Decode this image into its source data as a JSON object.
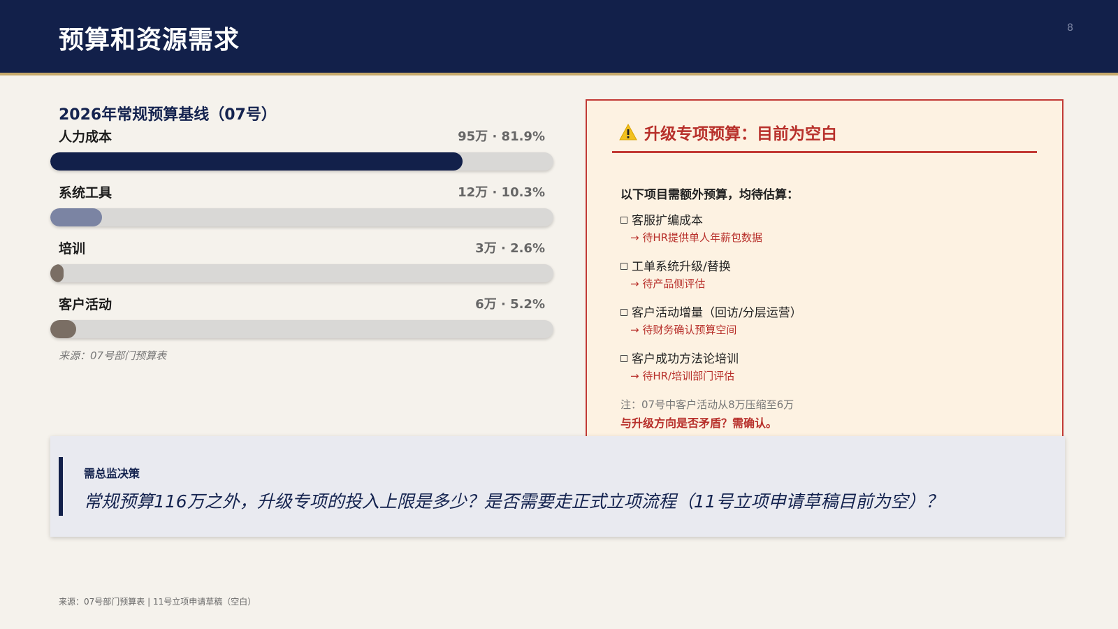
{
  "header": {
    "title": "预算和资源需求",
    "page_number": "8"
  },
  "baseline": {
    "title": "2026年常规预算基线（07号）",
    "items": [
      {
        "name": "人力成本",
        "amount": "95万 · 81.9%",
        "share": 0.819,
        "color": "#12204a"
      },
      {
        "name": "系统工具",
        "amount": "12万 · 10.3%",
        "share": 0.103,
        "color": "#7b84a3"
      },
      {
        "name": "培训",
        "amount": "3万 · 2.6%",
        "share": 0.026,
        "color": "#7a6e64"
      },
      {
        "name": "客户活动",
        "amount": "6万 · 5.2%",
        "share": 0.052,
        "color": "#7a6e64"
      }
    ],
    "source": "来源：07号部门预算表"
  },
  "upgrade": {
    "icon": "warning-icon",
    "title": "升级专项预算：目前为空白",
    "intro": "以下项目需额外预算，均待估算：",
    "items": [
      {
        "name": "客服扩编成本",
        "note": "→ 待HR提供单人年薪包数据"
      },
      {
        "name": "工单系统升级/替换",
        "note": "→ 待产品侧评估"
      },
      {
        "name": "客户活动增量（回访/分层运营）",
        "note": "→ 待财务确认预算空间"
      },
      {
        "name": "客户成功方法论培训",
        "note": "→ 待HR/培训部门评估"
      }
    ],
    "note_line1": "注：07号中客户活动从8万压缩至6万",
    "note_line2": "与升级方向是否矛盾？需确认。"
  },
  "decision": {
    "label": "需总监决策",
    "question": "常规预算116万之外，升级专项的投入上限是多少？是否需要走正式立项流程（11号立项申请草稿目前为空）？"
  },
  "footer": {
    "source": "来源：07号部门预算表 | 11号立项申请草稿（空白）"
  },
  "colors": {
    "navy": "#12204a",
    "gold": "#c6a96b",
    "alert_red": "#c23a35",
    "warning_yellow": "#f2c01e"
  }
}
